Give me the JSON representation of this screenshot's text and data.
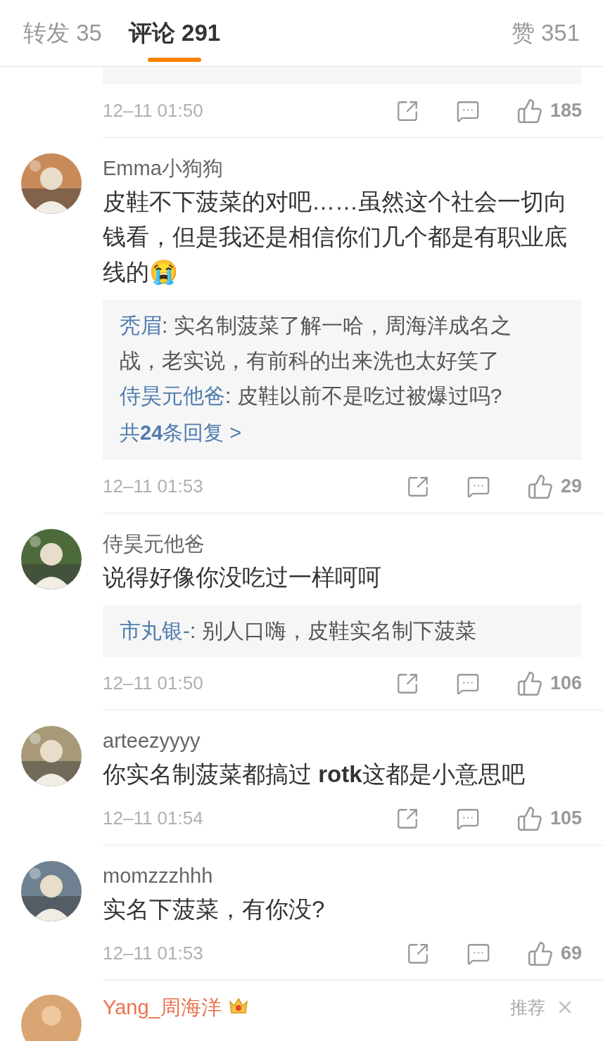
{
  "tabs": [
    {
      "label": "转发 35",
      "selected": false
    },
    {
      "label": "评论 291",
      "selected": true
    },
    {
      "label": "赞 351",
      "selected": false
    }
  ],
  "previous_comment_footer": {
    "time": "12–11 01:50",
    "likes": "185"
  },
  "comments": [
    {
      "name": "Emma小狗狗",
      "text": "皮鞋不下菠菜的对吧……虽然这个社会一切向钱看，但是我还是相信你们几个都是有职业底线的😭",
      "replies": [
        {
          "author": "秃眉",
          "text": ": 实名制菠菜了解一哈，周海洋成名之战，老实说，有前科的出来洗也太好笑了"
        },
        {
          "author": "侍昊元他爸",
          "text": ": 皮鞋以前不是吃过被爆过吗?"
        }
      ],
      "more_replies": "共**24**条回复 >",
      "time": "12–11 01:53",
      "likes": "29"
    },
    {
      "name": "侍昊元他爸",
      "text": "说得好像你没吃过一样呵呵",
      "replies": [
        {
          "author": "市丸银-",
          "text": ": 别人口嗨，皮鞋实名制下菠菜"
        }
      ],
      "time": "12–11 01:50",
      "likes": "106"
    },
    {
      "name": "arteezyyyy",
      "text": "你实名制菠菜都搞过 **rotk**这都是小意思吧",
      "time": "12–11 01:54",
      "likes": "105"
    },
    {
      "name": "momzzzhhh",
      "text": "实名下菠菜，有你没?",
      "time": "12–11 01:53",
      "likes": "69"
    }
  ],
  "last_comment": {
    "name": "Yang_周海洋",
    "label": "推荐"
  }
}
